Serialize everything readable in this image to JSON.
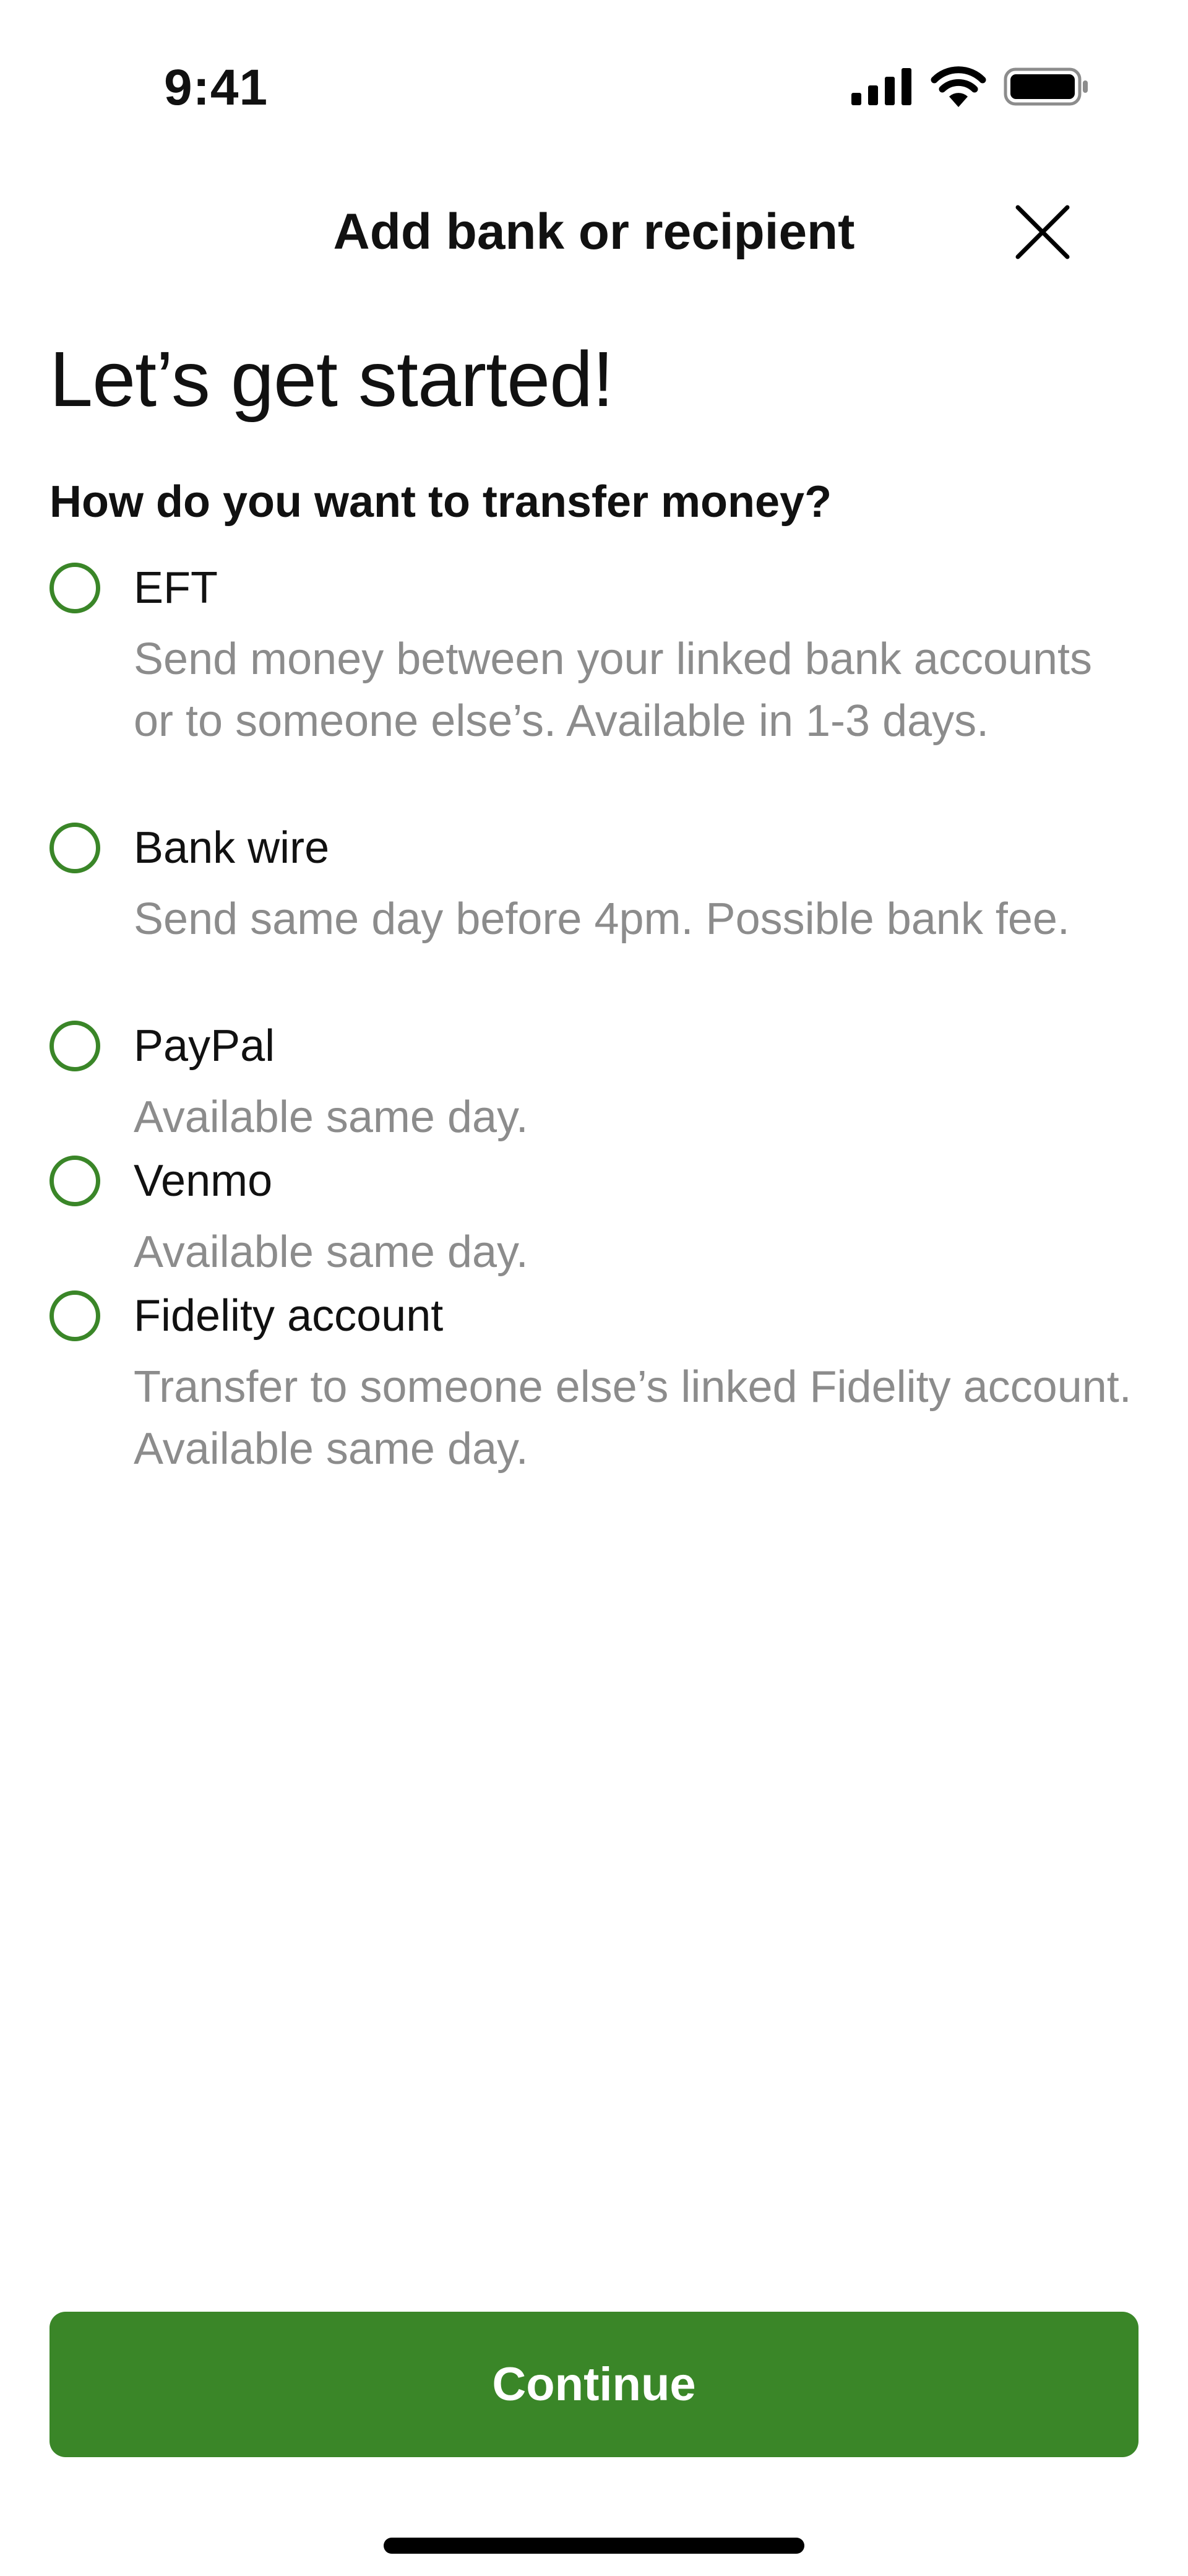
{
  "status_bar": {
    "time": "9:41",
    "icons": [
      "signal-icon",
      "wifi-icon",
      "battery-icon"
    ]
  },
  "header": {
    "title": "Add bank or recipient",
    "close_icon": "close-icon"
  },
  "page": {
    "title": "Let’s get started!",
    "question": "How do you want to transfer money?"
  },
  "options": [
    {
      "label": "EFT",
      "description": "Send money between your linked bank accounts or to someone else’s. Available in 1-3 days."
    },
    {
      "label": "Bank wire",
      "description": "Send same day before 4pm. Possible bank fee."
    },
    {
      "label": "PayPal",
      "description": "Available same day."
    },
    {
      "label": "Venmo",
      "description": "Available same day."
    },
    {
      "label": "Fidelity account",
      "description": "Transfer to someone else’s linked Fidelity account. Available same day."
    }
  ],
  "continue_button": {
    "label": "Continue"
  },
  "colors": {
    "accent": "#3a8628",
    "text": "#111111",
    "secondary_text": "#8c8c8c",
    "background": "#ffffff"
  }
}
